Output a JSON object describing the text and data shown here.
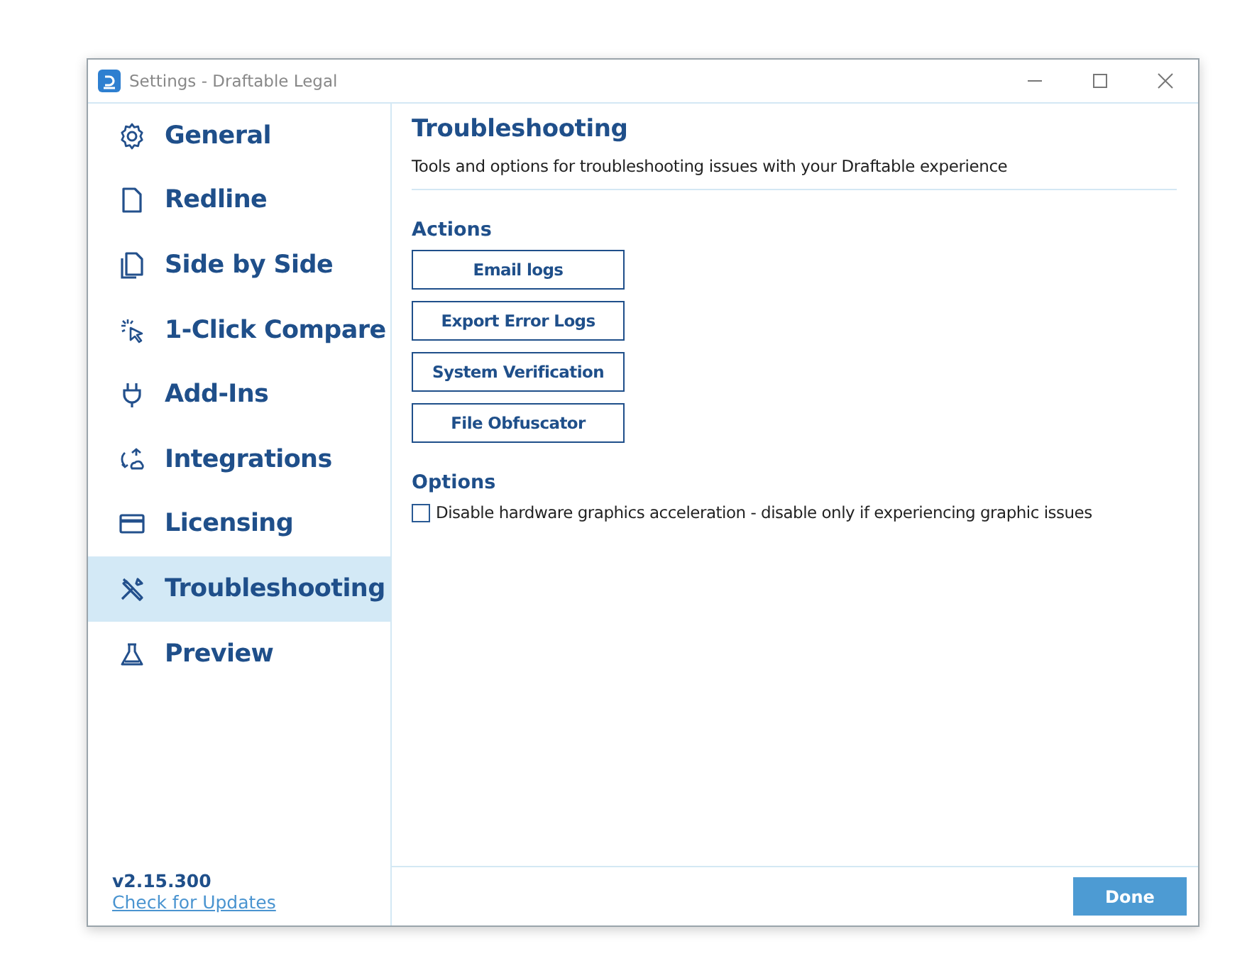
{
  "window": {
    "title": "Settings - Draftable Legal"
  },
  "sidebar": {
    "items": [
      {
        "label": "General",
        "kind": "gear",
        "selected": false
      },
      {
        "label": "Redline",
        "kind": "page",
        "selected": false
      },
      {
        "label": "Side by Side",
        "kind": "pages",
        "selected": false
      },
      {
        "label": "1-Click Compare",
        "kind": "click",
        "selected": false
      },
      {
        "label": "Add-Ins",
        "kind": "plug",
        "selected": false
      },
      {
        "label": "Integrations",
        "kind": "cycle",
        "selected": false
      },
      {
        "label": "Licensing",
        "kind": "card",
        "selected": false
      },
      {
        "label": "Troubleshooting",
        "kind": "tools",
        "selected": true
      },
      {
        "label": "Preview",
        "kind": "flask",
        "selected": false
      }
    ],
    "version": "v2.15.300",
    "update_link": "Check for Updates"
  },
  "content": {
    "title": "Troubleshooting",
    "description": "Tools and options for troubleshooting issues with your Draftable experience",
    "actions": {
      "heading": "Actions",
      "buttons": [
        "Email logs",
        "Export Error Logs",
        "System Verification",
        "File Obfuscator"
      ]
    },
    "options": {
      "heading": "Options",
      "items": [
        {
          "label": "Disable hardware graphics acceleration - disable only if experiencing graphic issues",
          "checked": false
        }
      ]
    }
  },
  "footer": {
    "done_button": "Done"
  }
}
